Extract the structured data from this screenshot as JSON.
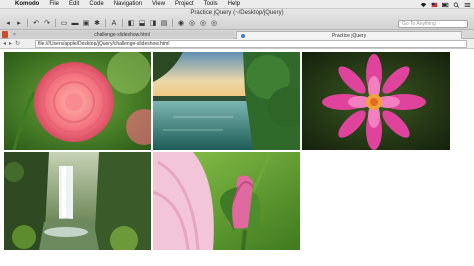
{
  "menubar": {
    "app_name": "Komodo",
    "items": [
      "File",
      "Edit",
      "Code",
      "Navigation",
      "View",
      "Project",
      "Tools",
      "Help"
    ]
  },
  "window": {
    "title": "Practice jQuery (~/Desktop/jQuery)"
  },
  "toolbar": {
    "goto_placeholder": "Go To Anything"
  },
  "tabs": [
    {
      "label": "challenge-slideshow.html"
    },
    {
      "label": "Practice jQuery"
    }
  ],
  "address_bar": {
    "url": "file:///Users/apple/Desktop/jQuery/challenge-slideshow.html"
  },
  "images": [
    {
      "name": "pink-dahlia-image"
    },
    {
      "name": "lake-sunset-image"
    },
    {
      "name": "magenta-flower-image"
    },
    {
      "name": "waterfall-image"
    },
    {
      "name": "pink-rosebud-image"
    }
  ],
  "colors": {
    "menubar_bg": "#ececec",
    "toolbar_bg": "#dcdcdc",
    "tab_active_bg": "#f3f3f3",
    "page_bg": "#ffffff"
  }
}
